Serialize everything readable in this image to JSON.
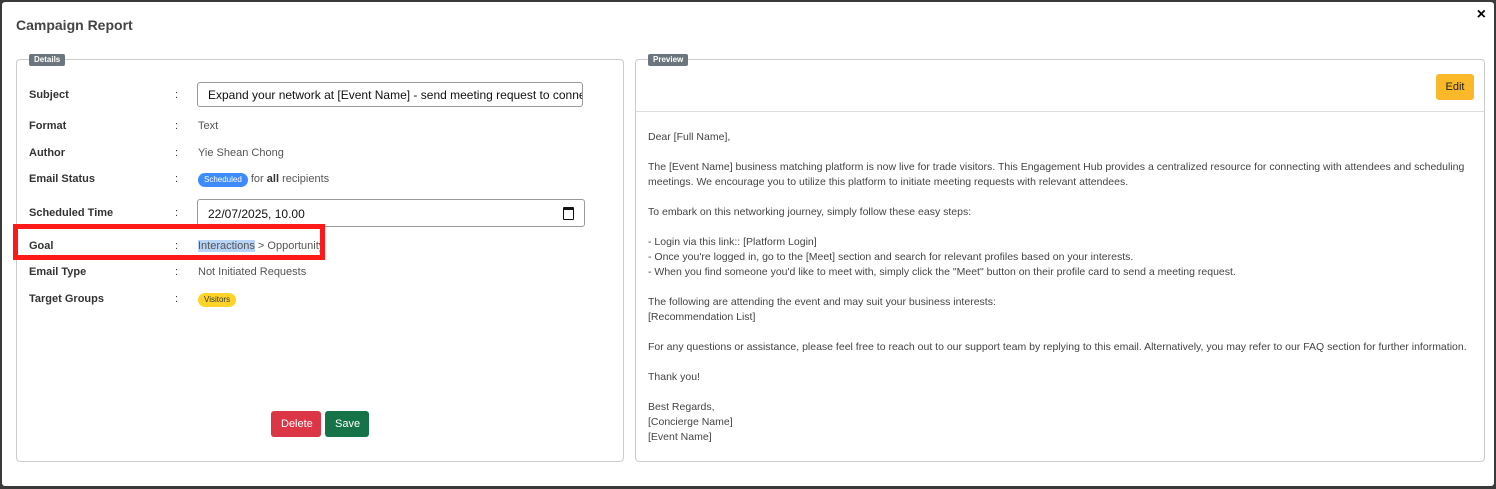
{
  "backdrop": {
    "text": "...Subject: ... [Full Name] ... ... ..."
  },
  "modal": {
    "title": "Campaign Report",
    "close_label": "×"
  },
  "details": {
    "legend": "Details",
    "subject_label": "Subject",
    "subject_value": "Expand your network at [Event Name] - send meeting request to connect",
    "format_label": "Format",
    "format_value": "Text",
    "author_label": "Author",
    "author_value": "Yie Shean Chong",
    "status_label": "Email Status",
    "status_badge": "Scheduled",
    "status_for": "for",
    "status_all": "all",
    "status_recipients": "recipients",
    "scheduled_label": "Scheduled Time",
    "scheduled_value": "22/07/2025, 10.00",
    "goal_label": "Goal",
    "goal_part1": "Interactions",
    "goal_part2": " > Opportunity",
    "email_type_label": "Email Type",
    "email_type_value": "Not Initiated Requests",
    "target_label": "Target Groups",
    "target_badge": "Visitors",
    "colon": ":",
    "delete_label": "Delete",
    "save_label": "Save"
  },
  "preview": {
    "legend": "Preview",
    "edit_label": "Edit",
    "greeting": "Dear [Full Name],",
    "para1": "The [Event Name] business matching platform is now live for trade visitors. This Engagement Hub provides a centralized resource for connecting with attendees and scheduling meetings. We encourage you to utilize this platform to initiate meeting requests with relevant attendees.",
    "para2": "To embark on this networking journey, simply follow these easy steps:",
    "step1": "- Login via this link:: [Platform Login]",
    "step2": "- Once you're logged in, go to the [Meet] section and search for relevant profiles based on your interests.",
    "step3": "- When you find someone you'd like to meet with, simply click the \"Meet\" button on their profile card to send a meeting request.",
    "para3a": "The following are attending the event and may suit your business interests:",
    "para3b": "[Recommendation List]",
    "para4": "For any questions or assistance, please feel free to reach out to our support team by replying to this email. Alternatively, you may refer to our FAQ section for further information.",
    "thanks": "Thank you!",
    "regards": "Best Regards,",
    "concierge": "[Concierge Name]",
    "event": "[Event Name]"
  }
}
